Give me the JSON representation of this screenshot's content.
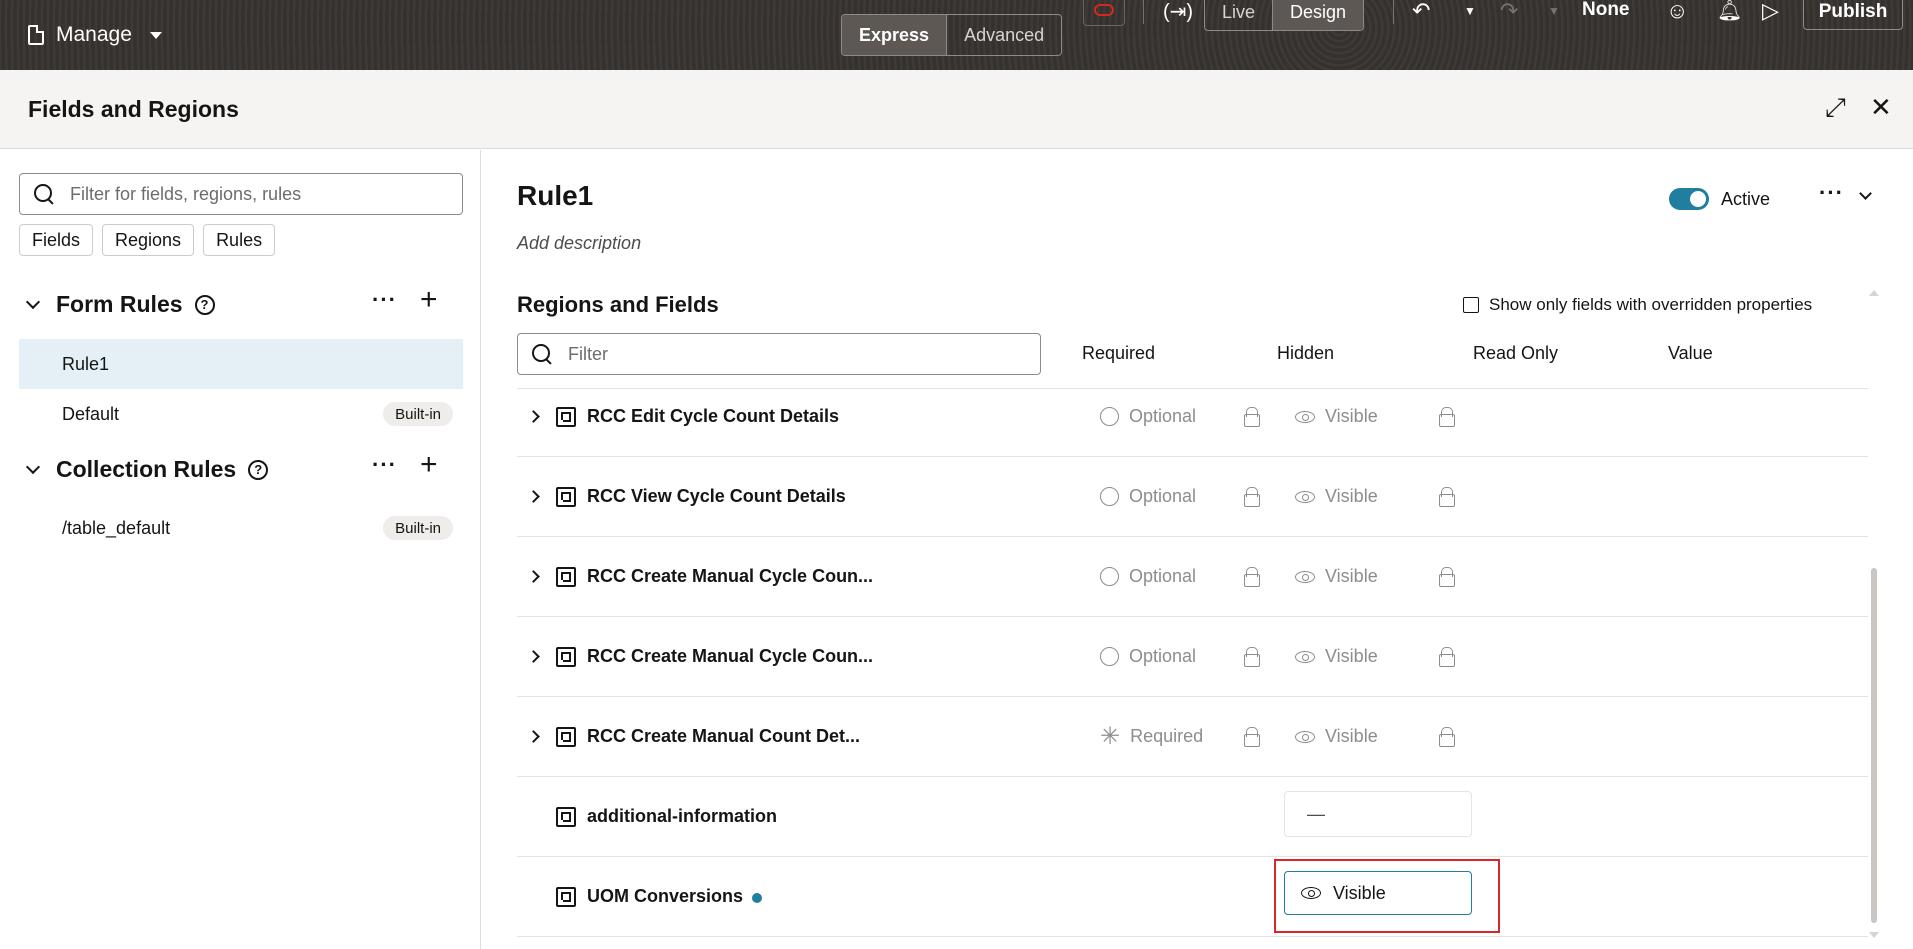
{
  "topbar": {
    "manage_label": "Manage",
    "mode_express": "Express",
    "mode_advanced": "Advanced",
    "view_live": "Live",
    "view_design": "Design",
    "sandbox_label": "None",
    "publish_label": "Publish"
  },
  "drawer": {
    "title": "Fields and Regions"
  },
  "left": {
    "search_placeholder": "Filter for fields, regions, rules",
    "chips": [
      "Fields",
      "Regions",
      "Rules"
    ],
    "form_rules_title": "Form Rules",
    "collection_rules_title": "Collection Rules",
    "form_rules": [
      {
        "label": "Rule1",
        "badge": ""
      },
      {
        "label": "Default",
        "badge": "Built-in"
      }
    ],
    "collection_rules": [
      {
        "label": "/table_default",
        "badge": "Built-in"
      }
    ]
  },
  "main": {
    "rule_title": "Rule1",
    "add_description": "Add description",
    "active_label": "Active",
    "regions_title": "Regions and Fields",
    "override_label": "Show only fields with overridden properties",
    "filter_placeholder": "Filter",
    "columns": [
      "Required",
      "Hidden",
      "Read Only",
      "Value"
    ],
    "rows": [
      {
        "name": "RCC Edit Cycle Count Details",
        "required": "Optional",
        "hidden": "Visible"
      },
      {
        "name": "RCC View Cycle Count Details",
        "required": "Optional",
        "hidden": "Visible"
      },
      {
        "name": "RCC Create Manual Cycle Coun...",
        "required": "Optional",
        "hidden": "Visible"
      },
      {
        "name": "RCC Create Manual Cycle Coun...",
        "required": "Optional",
        "hidden": "Visible"
      },
      {
        "name": "RCC Create Manual Count Det...",
        "required": "Required",
        "hidden": "Visible"
      },
      {
        "name": "additional-information",
        "hidden_value": "—"
      },
      {
        "name": "UOM Conversions",
        "hidden_value": "Visible"
      }
    ]
  },
  "colors": {
    "accent": "#227e9e",
    "highlight": "#d62828",
    "topbar": "#3a3632"
  }
}
